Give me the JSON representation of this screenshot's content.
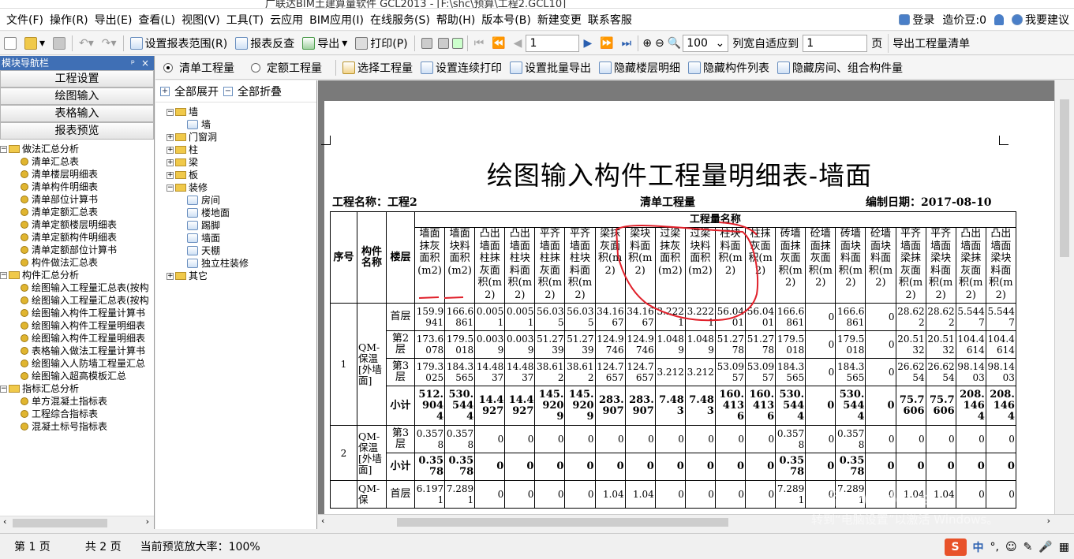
{
  "titlebar": {
    "text": "广联达BIM土建算量软件 GCL2013 - [F:\\shc\\预算\\工程2.GCL10]"
  },
  "menu": [
    "文件(F)",
    "操作(R)",
    "导出(E)",
    "查看(L)",
    "视图(V)",
    "工具(T)",
    "云应用",
    "BIM应用(I)",
    "在线服务(S)",
    "帮助(H)",
    "版本号(B)",
    "新建变更",
    "联系客服"
  ],
  "menu_right": {
    "login": "登录",
    "cost": "造价豆:0",
    "suggest": "我要建议"
  },
  "toolbar": {
    "set_range": "设置报表范围(R)",
    "check": "报表反查",
    "export": "导出",
    "print": "打印(P)",
    "page_value": "1",
    "zoom_value": "100",
    "fit": "列宽自适应到",
    "fit_value": "1",
    "page_unit": "页",
    "export_bill": "导出工程量清单"
  },
  "sidebar": {
    "title": "模块导航栏",
    "pin": "ᵖ",
    "close": "×",
    "nav": [
      "工程设置",
      "绘图输入",
      "表格输入",
      "报表预览"
    ],
    "groups": [
      {
        "label": "做法汇总分析",
        "items": [
          "清单汇总表",
          "清单楼层明细表",
          "清单构件明细表",
          "清单部位计算书",
          "清单定额汇总表",
          "清单定额楼层明细表",
          "清单定额构件明细表",
          "清单定额部位计算书",
          "构件做法汇总表"
        ]
      },
      {
        "label": "构件汇总分析",
        "items": [
          "绘图输入工程量汇总表(按构",
          "绘图输入工程量汇总表(按构",
          "绘图输入构件工程量计算书",
          "绘图输入构件工程量明细表",
          "绘图输入构件工程量明细表",
          "表格输入做法工程量计算书",
          "绘图输入人防墙工程量汇总",
          "绘图输入超高模板汇总"
        ]
      },
      {
        "label": "指标汇总分析",
        "items": [
          "单方混凝土指标表",
          "工程综合指标表",
          "混凝土标号指标表"
        ]
      }
    ]
  },
  "toolbar2": {
    "radio1": "清单工程量",
    "radio2": "定额工程量",
    "select_qty": "选择工程量",
    "cont_print": "设置连续打印",
    "batch_export": "设置批量导出",
    "hide_floor": "隐藏楼层明细",
    "hide_comp": "隐藏构件列表",
    "hide_room": "隐藏房间、组合构件量"
  },
  "comp_tree": {
    "expand_all": "全部展开",
    "collapse_all": "全部折叠",
    "nodes": [
      {
        "label": "墙",
        "level": 0,
        "toggle": "−",
        "type": "folder"
      },
      {
        "label": "墙",
        "level": 1,
        "type": "leaf"
      },
      {
        "label": "门窗洞",
        "level": 0,
        "toggle": "+",
        "type": "folder"
      },
      {
        "label": "柱",
        "level": 0,
        "toggle": "+",
        "type": "folder"
      },
      {
        "label": "梁",
        "level": 0,
        "toggle": "+",
        "type": "folder"
      },
      {
        "label": "板",
        "level": 0,
        "toggle": "+",
        "type": "folder"
      },
      {
        "label": "装修",
        "level": 0,
        "toggle": "−",
        "type": "folder"
      },
      {
        "label": "房间",
        "level": 1,
        "type": "leaf"
      },
      {
        "label": "楼地面",
        "level": 1,
        "type": "leaf"
      },
      {
        "label": "踢脚",
        "level": 1,
        "type": "leaf"
      },
      {
        "label": "墙面",
        "level": 1,
        "type": "leaf"
      },
      {
        "label": "天棚",
        "level": 1,
        "type": "leaf"
      },
      {
        "label": "独立柱装修",
        "level": 1,
        "type": "leaf"
      },
      {
        "label": "其它",
        "level": 0,
        "toggle": "+",
        "type": "folder"
      }
    ]
  },
  "report": {
    "title": "绘图输入构件工程量明细表-墙面",
    "project": "工程名称：工程2",
    "type": "清单工程量",
    "date": "编制日期：2017-08-10",
    "group_header": "工程量名称",
    "col_seq": "序号",
    "col_comp": "构件名称",
    "col_floor": "楼层",
    "qty_headers": [
      "墙面抹灰面积(m2)",
      "墙面块料面积(m2)",
      "凸出墙面柱抹灰面积(m2)",
      "凸出墙面柱块料面积(m2)",
      "平齐墙面柱抹灰面积(m2)",
      "平齐墙面柱块料面积(m2)",
      "梁抹灰面积(m2)",
      "梁块料面积(m2)",
      "过梁抹灰面积(m2)",
      "过梁块料面积(m2)",
      "柱块料面积(m2)",
      "柱抹灰面积(m2)",
      "砖墙面抹灰面积(m2)",
      "砼墙面抹灰面积(m2)",
      "砖墙面块料面积(m2)",
      "砼墙面块料面积(m2)",
      "平齐墙面梁抹灰面积(m2)",
      "平齐墙面梁块料面积(m2)",
      "凸出墙面梁抹灰面积(m2)",
      "凸出墙面梁块料面积(m2)"
    ],
    "rows": [
      {
        "seq": "1",
        "comp": "QM-保温[外墙面]",
        "floor": "首层",
        "vals": [
          "159.9941",
          "166.6861",
          "0.0051",
          "0.0051",
          "56.035",
          "56.035",
          "34.1667",
          "34.1667",
          "3.2221",
          "3.2221",
          "56.0401",
          "56.0401",
          "166.6861",
          "0",
          "166.6861",
          "0",
          "28.622",
          "28.622",
          "5.5447",
          "5.5447"
        ]
      },
      {
        "seq": "",
        "comp": "",
        "floor": "第2层",
        "vals": [
          "173.6078",
          "179.5018",
          "0.0039",
          "0.0039",
          "51.2739",
          "51.2739",
          "124.9746",
          "124.9746",
          "1.0489",
          "1.0489",
          "51.2778",
          "51.2778",
          "179.5018",
          "0",
          "179.5018",
          "0",
          "20.5132",
          "20.5132",
          "104.4614",
          "104.4614"
        ]
      },
      {
        "seq": "",
        "comp": "",
        "floor": "第3层",
        "vals": [
          "179.3025",
          "184.3565",
          "14.4837",
          "14.4837",
          "38.612",
          "38.612",
          "124.7657",
          "124.7657",
          "3.212",
          "3.212",
          "53.0957",
          "53.0957",
          "184.3565",
          "0",
          "184.3565",
          "0",
          "26.6254",
          "26.6254",
          "98.1403",
          "98.1403"
        ]
      },
      {
        "seq": "",
        "comp": "",
        "floor": "小计",
        "sub": true,
        "vals": [
          "512.9044",
          "530.5444",
          "14.4927",
          "14.4927",
          "145.9209",
          "145.9209",
          "283.907",
          "283.907",
          "7.483",
          "7.483",
          "160.4136",
          "160.4136",
          "530.5444",
          "0",
          "530.5444",
          "0",
          "75.7606",
          "75.7606",
          "208.1464",
          "208.1464"
        ]
      },
      {
        "seq": "2",
        "comp": "QM-保温[外墙面]",
        "floor": "第3层",
        "vals": [
          "0.3578",
          "0.3578",
          "0",
          "0",
          "0",
          "0",
          "0",
          "0",
          "0",
          "0",
          "0",
          "0",
          "0.3578",
          "0",
          "0.3578",
          "0",
          "0",
          "0",
          "0",
          "0"
        ]
      },
      {
        "seq": "",
        "comp": "",
        "floor": "小计",
        "sub": true,
        "vals": [
          "0.3578",
          "0.3578",
          "0",
          "0",
          "0",
          "0",
          "0",
          "0",
          "0",
          "0",
          "0",
          "0",
          "0.3578",
          "0",
          "0.3578",
          "0",
          "0",
          "0",
          "0",
          "0"
        ]
      },
      {
        "seq": "",
        "comp": "QM-保",
        "floor": "首层",
        "vals": [
          "6.1971",
          "7.2891",
          "0",
          "0",
          "0",
          "0",
          "1.04",
          "1.04",
          "0",
          "0",
          "0",
          "0",
          "7.2891",
          "0",
          "7.2891",
          "0",
          "1.04",
          "1.04",
          "0",
          "0"
        ]
      }
    ]
  },
  "watermark": {
    "line1": "激活 Windows",
    "line2": "转到“电脑设置”以激活 Windows。"
  },
  "status": {
    "page": "第 1 页",
    "total": "共 2 页",
    "zoom": "当前预览放大率：100%"
  },
  "ime": {
    "logo": "S",
    "lang": "中"
  },
  "colors": {
    "accent": "#3f6fb5",
    "annotation": "#e0202a"
  }
}
